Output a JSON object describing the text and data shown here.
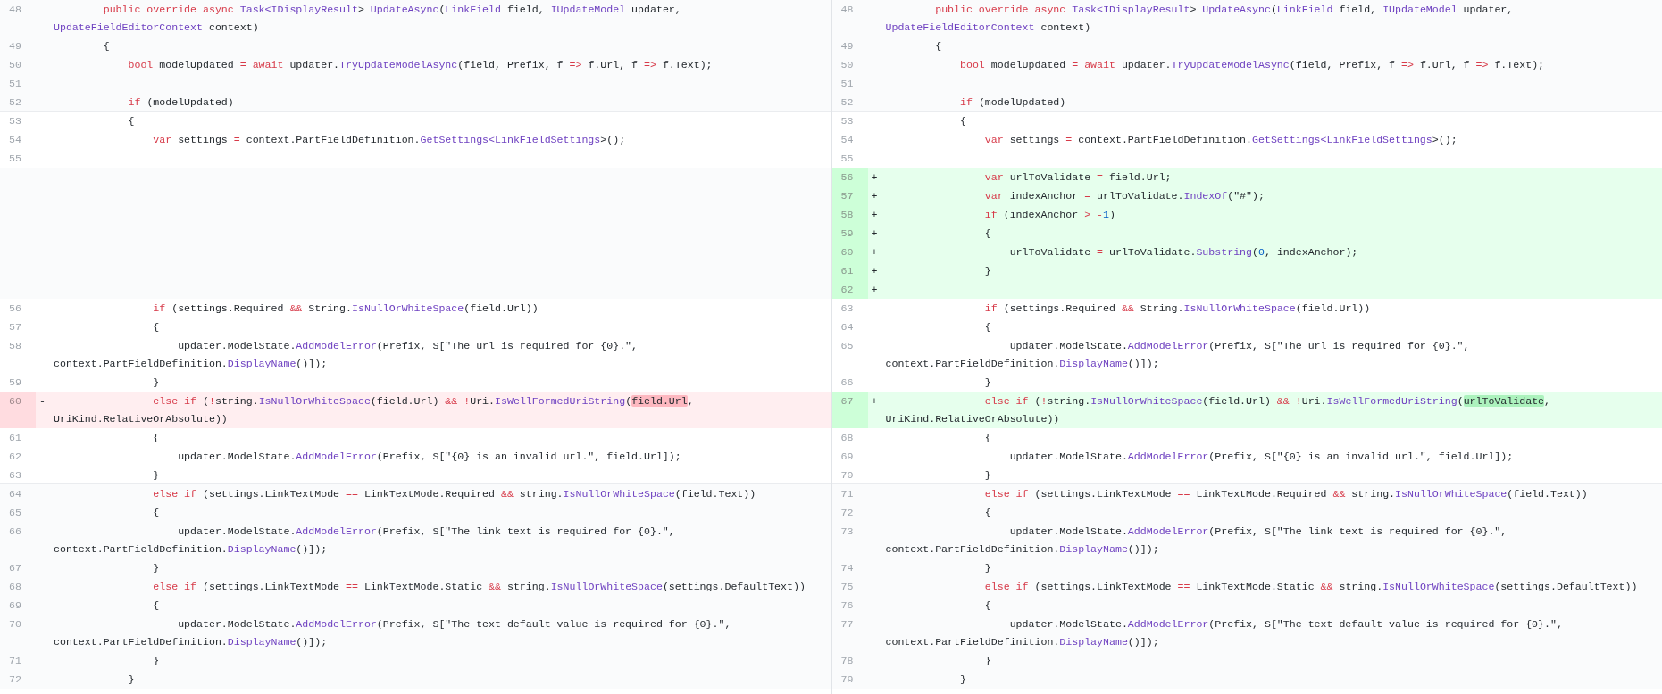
{
  "panes": [
    {
      "rows": [
        {
          "num": "48",
          "kind": "expanded",
          "code": [
            {
              "kind": "keyword",
              "text": "        public override async "
            },
            {
              "kind": "name",
              "text": "Task<IDisplayResult"
            },
            {
              "text": "> "
            },
            {
              "kind": "name",
              "text": "UpdateAsync"
            },
            {
              "text": "("
            },
            {
              "kind": "name",
              "text": "LinkField"
            },
            {
              "text": " field, "
            },
            {
              "kind": "name",
              "text": "IUpdateModel"
            },
            {
              "text": " updater, "
            },
            {
              "kind": "name",
              "text": "UpdateFieldEditorContext"
            },
            {
              "text": " context)"
            }
          ]
        },
        {
          "num": "49",
          "kind": "expanded",
          "code": [
            {
              "text": "        {"
            }
          ]
        },
        {
          "num": "50",
          "kind": "expanded",
          "code": [
            {
              "kind": "keyword",
              "text": "            bool"
            },
            {
              "text": " modelUpdated "
            },
            {
              "kind": "keyword",
              "text": "= await"
            },
            {
              "text": " updater."
            },
            {
              "kind": "name",
              "text": "TryUpdateModelAsync"
            },
            {
              "text": "(field, Prefix, f "
            },
            {
              "kind": "keyword",
              "text": "=>"
            },
            {
              "text": " f.Url, f "
            },
            {
              "kind": "keyword",
              "text": "=>"
            },
            {
              "text": " f.Text);"
            }
          ]
        },
        {
          "num": "51",
          "kind": "expanded"
        },
        {
          "num": "52",
          "kind": "expanded",
          "code": [
            {
              "kind": "keyword",
              "text": "            if"
            },
            {
              "text": " (modelUpdated)"
            }
          ]
        },
        {
          "num": "53",
          "kind": "context",
          "code": [
            {
              "text": "            {"
            }
          ]
        },
        {
          "num": "54",
          "kind": "context",
          "code": [
            {
              "kind": "keyword",
              "text": "                var"
            },
            {
              "text": " settings "
            },
            {
              "kind": "keyword",
              "text": "="
            },
            {
              "text": " context.PartFieldDefinition."
            },
            {
              "kind": "name",
              "text": "GetSettings<LinkFieldSettings"
            },
            {
              "text": ">();"
            }
          ]
        },
        {
          "num": "55",
          "kind": "context"
        },
        {
          "kind": "empty"
        },
        {
          "kind": "empty"
        },
        {
          "kind": "empty"
        },
        {
          "kind": "empty"
        },
        {
          "kind": "empty"
        },
        {
          "kind": "empty"
        },
        {
          "kind": "empty"
        },
        {
          "num": "56",
          "kind": "context",
          "code": [
            {
              "kind": "keyword",
              "text": "                if"
            },
            {
              "text": " (settings.Required "
            },
            {
              "kind": "keyword",
              "text": "&&"
            },
            {
              "text": " String."
            },
            {
              "kind": "name",
              "text": "IsNullOrWhiteSpace"
            },
            {
              "text": "(field.Url))"
            }
          ]
        },
        {
          "num": "57",
          "kind": "context",
          "code": [
            {
              "text": "                {"
            }
          ]
        },
        {
          "num": "58",
          "kind": "context",
          "code": [
            {
              "text": "                    updater.ModelState."
            },
            {
              "kind": "name",
              "text": "AddModelError"
            },
            {
              "text": "(Prefix, S[\"The url is required for {0}.\", context.PartFieldDefinition."
            },
            {
              "kind": "name",
              "text": "DisplayName"
            },
            {
              "text": "()]);"
            }
          ]
        },
        {
          "num": "59",
          "kind": "context",
          "code": [
            {
              "text": "                }"
            }
          ]
        },
        {
          "num": "60",
          "kind": "removed",
          "marker": "-",
          "code": [
            {
              "kind": "keyword",
              "text": "                else if"
            },
            {
              "text": " ("
            },
            {
              "kind": "keyword",
              "text": "!"
            },
            {
              "text": "string."
            },
            {
              "kind": "name",
              "text": "IsNullOrWhiteSpace"
            },
            {
              "text": "(field.Url) "
            },
            {
              "kind": "keyword",
              "text": "&& !"
            },
            {
              "text": "Uri."
            },
            {
              "kind": "name",
              "text": "IsWellFormedUriString"
            },
            {
              "text": "("
            },
            {
              "kind": "highlight",
              "text": "field.Url"
            },
            {
              "text": ", UriKind.RelativeOrAbsolute))"
            }
          ]
        },
        {
          "num": "61",
          "kind": "context",
          "code": [
            {
              "text": "                {"
            }
          ]
        },
        {
          "num": "62",
          "kind": "context",
          "code": [
            {
              "text": "                    updater.ModelState."
            },
            {
              "kind": "name",
              "text": "AddModelError"
            },
            {
              "text": "(Prefix, S[\"{0} is an invalid url.\", field.Url]);"
            }
          ]
        },
        {
          "num": "63",
          "kind": "context",
          "code": [
            {
              "text": "                }"
            }
          ]
        },
        {
          "num": "64",
          "kind": "expanded",
          "code": [
            {
              "kind": "keyword",
              "text": "                else if"
            },
            {
              "text": " (settings.LinkTextMode "
            },
            {
              "kind": "keyword",
              "text": "=="
            },
            {
              "text": " LinkTextMode.Required "
            },
            {
              "kind": "keyword",
              "text": "&&"
            },
            {
              "text": " string."
            },
            {
              "kind": "name",
              "text": "IsNullOrWhiteSpace"
            },
            {
              "text": "(field.Text))"
            }
          ]
        },
        {
          "num": "65",
          "kind": "expanded",
          "code": [
            {
              "text": "                {"
            }
          ]
        },
        {
          "num": "66",
          "kind": "expanded",
          "code": [
            {
              "text": "                    updater.ModelState."
            },
            {
              "kind": "name",
              "text": "AddModelError"
            },
            {
              "text": "(Prefix, S[\"The link text is required for {0}.\", context.PartFieldDefinition."
            },
            {
              "kind": "name",
              "text": "DisplayName"
            },
            {
              "text": "()]);"
            }
          ]
        },
        {
          "num": "67",
          "kind": "expanded",
          "code": [
            {
              "text": "                }"
            }
          ]
        },
        {
          "num": "68",
          "kind": "expanded",
          "code": [
            {
              "kind": "keyword",
              "text": "                else if"
            },
            {
              "text": " (settings.LinkTextMode "
            },
            {
              "kind": "keyword",
              "text": "=="
            },
            {
              "text": " LinkTextMode.Static "
            },
            {
              "kind": "keyword",
              "text": "&&"
            },
            {
              "text": " string."
            },
            {
              "kind": "name",
              "text": "IsNullOrWhiteSpace"
            },
            {
              "text": "(settings.DefaultText))"
            }
          ]
        },
        {
          "num": "69",
          "kind": "expanded",
          "code": [
            {
              "text": "                {"
            }
          ]
        },
        {
          "num": "70",
          "kind": "expanded",
          "code": [
            {
              "text": "                    updater.ModelState."
            },
            {
              "kind": "name",
              "text": "AddModelError"
            },
            {
              "text": "(Prefix, S[\"The text default value is required for {0}.\", context.PartFieldDefinition."
            },
            {
              "kind": "name",
              "text": "DisplayName"
            },
            {
              "text": "()]);"
            }
          ]
        },
        {
          "num": "71",
          "kind": "expanded",
          "code": [
            {
              "text": "                }"
            }
          ]
        },
        {
          "num": "72",
          "kind": "expanded",
          "code": [
            {
              "text": "            }"
            }
          ]
        }
      ]
    },
    {
      "rows": [
        {
          "num": "48",
          "kind": "expanded",
          "code": [
            {
              "kind": "keyword",
              "text": "        public override async "
            },
            {
              "kind": "name",
              "text": "Task<IDisplayResult"
            },
            {
              "text": "> "
            },
            {
              "kind": "name",
              "text": "UpdateAsync"
            },
            {
              "text": "("
            },
            {
              "kind": "name",
              "text": "LinkField"
            },
            {
              "text": " field, "
            },
            {
              "kind": "name",
              "text": "IUpdateModel"
            },
            {
              "text": " updater, "
            },
            {
              "kind": "name",
              "text": "UpdateFieldEditorContext"
            },
            {
              "text": " context)"
            }
          ]
        },
        {
          "num": "49",
          "kind": "expanded",
          "code": [
            {
              "text": "        {"
            }
          ]
        },
        {
          "num": "50",
          "kind": "expanded",
          "code": [
            {
              "kind": "keyword",
              "text": "            bool"
            },
            {
              "text": " modelUpdated "
            },
            {
              "kind": "keyword",
              "text": "= await"
            },
            {
              "text": " updater."
            },
            {
              "kind": "name",
              "text": "TryUpdateModelAsync"
            },
            {
              "text": "(field, Prefix, f "
            },
            {
              "kind": "keyword",
              "text": "=>"
            },
            {
              "text": " f.Url, f "
            },
            {
              "kind": "keyword",
              "text": "=>"
            },
            {
              "text": " f.Text);"
            }
          ]
        },
        {
          "num": "51",
          "kind": "expanded"
        },
        {
          "num": "52",
          "kind": "expanded",
          "code": [
            {
              "kind": "keyword",
              "text": "            if"
            },
            {
              "text": " (modelUpdated)"
            }
          ]
        },
        {
          "num": "53",
          "kind": "context",
          "code": [
            {
              "text": "            {"
            }
          ]
        },
        {
          "num": "54",
          "kind": "context",
          "code": [
            {
              "kind": "keyword",
              "text": "                var"
            },
            {
              "text": " settings "
            },
            {
              "kind": "keyword",
              "text": "="
            },
            {
              "text": " context.PartFieldDefinition."
            },
            {
              "kind": "name",
              "text": "GetSettings<LinkFieldSettings"
            },
            {
              "text": ">();"
            }
          ]
        },
        {
          "num": "55",
          "kind": "context"
        },
        {
          "num": "56",
          "kind": "added",
          "marker": "+",
          "code": [
            {
              "kind": "keyword",
              "text": "                var"
            },
            {
              "text": " urlToValidate "
            },
            {
              "kind": "keyword",
              "text": "="
            },
            {
              "text": " field.Url;"
            }
          ]
        },
        {
          "num": "57",
          "kind": "added",
          "marker": "+",
          "code": [
            {
              "kind": "keyword",
              "text": "                var"
            },
            {
              "text": " indexAnchor "
            },
            {
              "kind": "keyword",
              "text": "="
            },
            {
              "text": " urlToValidate."
            },
            {
              "kind": "name",
              "text": "IndexOf"
            },
            {
              "text": "(\"#\");"
            }
          ]
        },
        {
          "num": "58",
          "kind": "added",
          "marker": "+",
          "code": [
            {
              "kind": "keyword",
              "text": "                if"
            },
            {
              "text": " (indexAnchor "
            },
            {
              "kind": "keyword",
              "text": "> -"
            },
            {
              "kind": "number",
              "text": "1"
            },
            {
              "text": ")"
            }
          ]
        },
        {
          "num": "59",
          "kind": "added",
          "marker": "+",
          "code": [
            {
              "text": "                {"
            }
          ]
        },
        {
          "num": "60",
          "kind": "added",
          "marker": "+",
          "code": [
            {
              "text": "                    urlToValidate "
            },
            {
              "kind": "keyword",
              "text": "="
            },
            {
              "text": " urlToValidate."
            },
            {
              "kind": "name",
              "text": "Substring"
            },
            {
              "text": "("
            },
            {
              "kind": "number",
              "text": "0"
            },
            {
              "text": ", indexAnchor);"
            }
          ]
        },
        {
          "num": "61",
          "kind": "added",
          "marker": "+",
          "code": [
            {
              "text": "                }"
            }
          ]
        },
        {
          "num": "62",
          "kind": "added",
          "marker": "+"
        },
        {
          "num": "63",
          "kind": "context",
          "code": [
            {
              "kind": "keyword",
              "text": "                if"
            },
            {
              "text": " (settings.Required "
            },
            {
              "kind": "keyword",
              "text": "&&"
            },
            {
              "text": " String."
            },
            {
              "kind": "name",
              "text": "IsNullOrWhiteSpace"
            },
            {
              "text": "(field.Url))"
            }
          ]
        },
        {
          "num": "64",
          "kind": "context",
          "code": [
            {
              "text": "                {"
            }
          ]
        },
        {
          "num": "65",
          "kind": "context",
          "code": [
            {
              "text": "                    updater.ModelState."
            },
            {
              "kind": "name",
              "text": "AddModelError"
            },
            {
              "text": "(Prefix, S[\"The url is required for {0}.\", context.PartFieldDefinition."
            },
            {
              "kind": "name",
              "text": "DisplayName"
            },
            {
              "text": "()]);"
            }
          ]
        },
        {
          "num": "66",
          "kind": "context",
          "code": [
            {
              "text": "                }"
            }
          ]
        },
        {
          "num": "67",
          "kind": "added",
          "marker": "+",
          "code": [
            {
              "kind": "keyword",
              "text": "                else if"
            },
            {
              "text": " ("
            },
            {
              "kind": "keyword",
              "text": "!"
            },
            {
              "text": "string."
            },
            {
              "kind": "name",
              "text": "IsNullOrWhiteSpace"
            },
            {
              "text": "(field.Url) "
            },
            {
              "kind": "keyword",
              "text": "&& !"
            },
            {
              "text": "Uri."
            },
            {
              "kind": "name",
              "text": "IsWellFormedUriString"
            },
            {
              "text": "("
            },
            {
              "kind": "highlight",
              "text": "urlToValidate"
            },
            {
              "text": ", UriKind.RelativeOrAbsolute))"
            }
          ]
        },
        {
          "num": "68",
          "kind": "context",
          "code": [
            {
              "text": "                {"
            }
          ]
        },
        {
          "num": "69",
          "kind": "context",
          "code": [
            {
              "text": "                    updater.ModelState."
            },
            {
              "kind": "name",
              "text": "AddModelError"
            },
            {
              "text": "(Prefix, S[\"{0} is an invalid url.\", field.Url]);"
            }
          ]
        },
        {
          "num": "70",
          "kind": "context",
          "code": [
            {
              "text": "                }"
            }
          ]
        },
        {
          "num": "71",
          "kind": "expanded",
          "code": [
            {
              "kind": "keyword",
              "text": "                else if"
            },
            {
              "text": " (settings.LinkTextMode "
            },
            {
              "kind": "keyword",
              "text": "=="
            },
            {
              "text": " LinkTextMode.Required "
            },
            {
              "kind": "keyword",
              "text": "&&"
            },
            {
              "text": " string."
            },
            {
              "kind": "name",
              "text": "IsNullOrWhiteSpace"
            },
            {
              "text": "(field.Text))"
            }
          ]
        },
        {
          "num": "72",
          "kind": "expanded",
          "code": [
            {
              "text": "                {"
            }
          ]
        },
        {
          "num": "73",
          "kind": "expanded",
          "code": [
            {
              "text": "                    updater.ModelState."
            },
            {
              "kind": "name",
              "text": "AddModelError"
            },
            {
              "text": "(Prefix, S[\"The link text is required for {0}.\", context.PartFieldDefinition."
            },
            {
              "kind": "name",
              "text": "DisplayName"
            },
            {
              "text": "()]);"
            }
          ]
        },
        {
          "num": "74",
          "kind": "expanded",
          "code": [
            {
              "text": "                }"
            }
          ]
        },
        {
          "num": "75",
          "kind": "expanded",
          "code": [
            {
              "kind": "keyword",
              "text": "                else if"
            },
            {
              "text": " (settings.LinkTextMode "
            },
            {
              "kind": "keyword",
              "text": "=="
            },
            {
              "text": " LinkTextMode.Static "
            },
            {
              "kind": "keyword",
              "text": "&&"
            },
            {
              "text": " string."
            },
            {
              "kind": "name",
              "text": "IsNullOrWhiteSpace"
            },
            {
              "text": "(settings.DefaultText))"
            }
          ]
        },
        {
          "num": "76",
          "kind": "expanded",
          "code": [
            {
              "text": "                {"
            }
          ]
        },
        {
          "num": "77",
          "kind": "expanded",
          "code": [
            {
              "text": "                    updater.ModelState."
            },
            {
              "kind": "name",
              "text": "AddModelError"
            },
            {
              "text": "(Prefix, S[\"The text default value is required for {0}.\", context.PartFieldDefinition."
            },
            {
              "kind": "name",
              "text": "DisplayName"
            },
            {
              "text": "()]);"
            }
          ]
        },
        {
          "num": "78",
          "kind": "expanded",
          "code": [
            {
              "text": "                }"
            }
          ]
        },
        {
          "num": "79",
          "kind": "expanded",
          "code": [
            {
              "text": "            }"
            }
          ]
        }
      ]
    }
  ]
}
